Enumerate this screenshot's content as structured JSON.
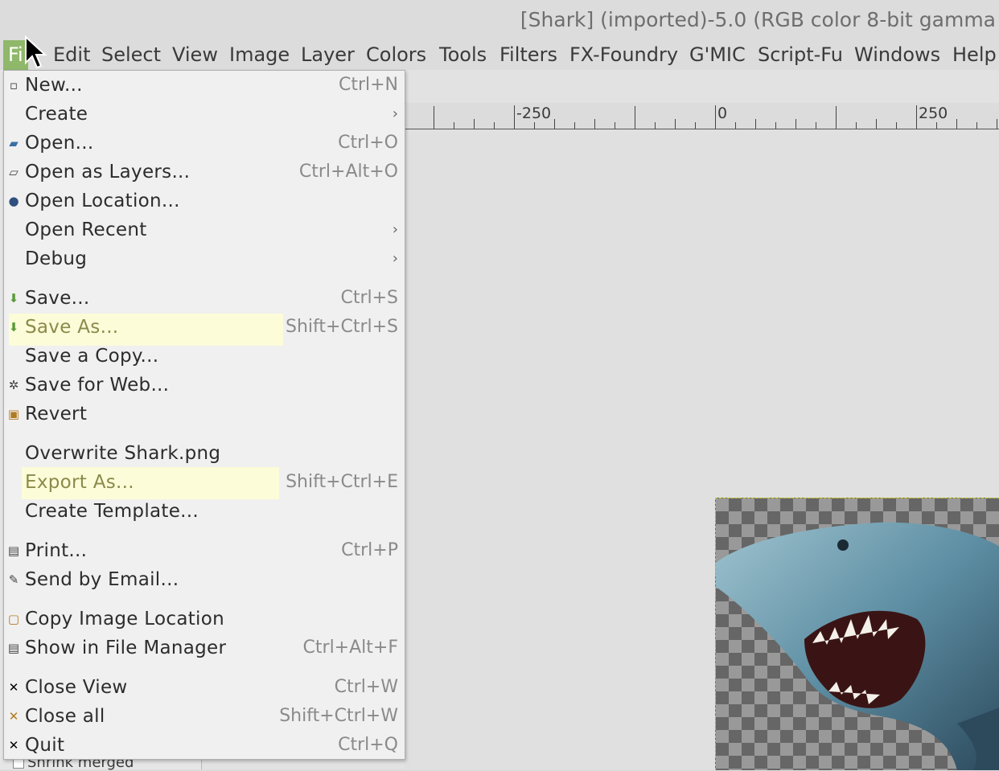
{
  "window": {
    "title": "[Shark] (imported)-5.0 (RGB color 8-bit gamma"
  },
  "menubar": {
    "items": [
      "Fi",
      "Edit",
      "Select",
      "View",
      "Image",
      "Layer",
      "Colors",
      "Tools",
      "Filters",
      "FX-Foundry",
      "G'MIC",
      "Script-Fu",
      "Windows",
      "Help"
    ],
    "active": "File"
  },
  "ruler": {
    "labels": [
      "-250",
      "0",
      "250"
    ]
  },
  "left_panel": {
    "shrink_merged": "Shrink merged"
  },
  "file_menu": {
    "items": [
      {
        "label": "New...",
        "shortcut": "Ctrl+N",
        "icon": "new-file-icon"
      },
      {
        "label": "Create",
        "submenu": "›"
      },
      {
        "label": "Open...",
        "shortcut": "Ctrl+O",
        "icon": "open-folder-icon"
      },
      {
        "label": "Open as Layers...",
        "shortcut": "Ctrl+Alt+O",
        "icon": "layers-icon"
      },
      {
        "label": "Open Location...",
        "icon": "globe-icon"
      },
      {
        "label": "Open Recent",
        "submenu": "›"
      },
      {
        "label": "Debug",
        "submenu": "›"
      },
      {
        "label": "Save...",
        "shortcut": "Ctrl+S",
        "icon": "save-icon"
      },
      {
        "label": "Save As...",
        "shortcut": "Shift+Ctrl+S",
        "icon": "save-as-icon",
        "highlight": true
      },
      {
        "label": "Save a Copy..."
      },
      {
        "label": "Save for Web...",
        "icon": "gear-icon"
      },
      {
        "label": "Revert",
        "icon": "revert-icon"
      },
      {
        "label": "Overwrite Shark.png"
      },
      {
        "label": "Export As...",
        "shortcut": "Shift+Ctrl+E",
        "highlight": true
      },
      {
        "label": "Create Template..."
      },
      {
        "label": "Print...",
        "shortcut": "Ctrl+P",
        "icon": "printer-icon"
      },
      {
        "label": "Send by Email...",
        "icon": "pen-icon"
      },
      {
        "label": "Copy Image Location",
        "icon": "clipboard-icon"
      },
      {
        "label": "Show in File Manager",
        "shortcut": "Ctrl+Alt+F",
        "icon": "file-manager-icon"
      },
      {
        "label": "Close View",
        "shortcut": "Ctrl+W",
        "icon": "close-icon"
      },
      {
        "label": "Close all",
        "shortcut": "Shift+Ctrl+W",
        "icon": "close-all-icon"
      },
      {
        "label": "Quit",
        "shortcut": "Ctrl+Q",
        "icon": "quit-icon"
      }
    ]
  }
}
